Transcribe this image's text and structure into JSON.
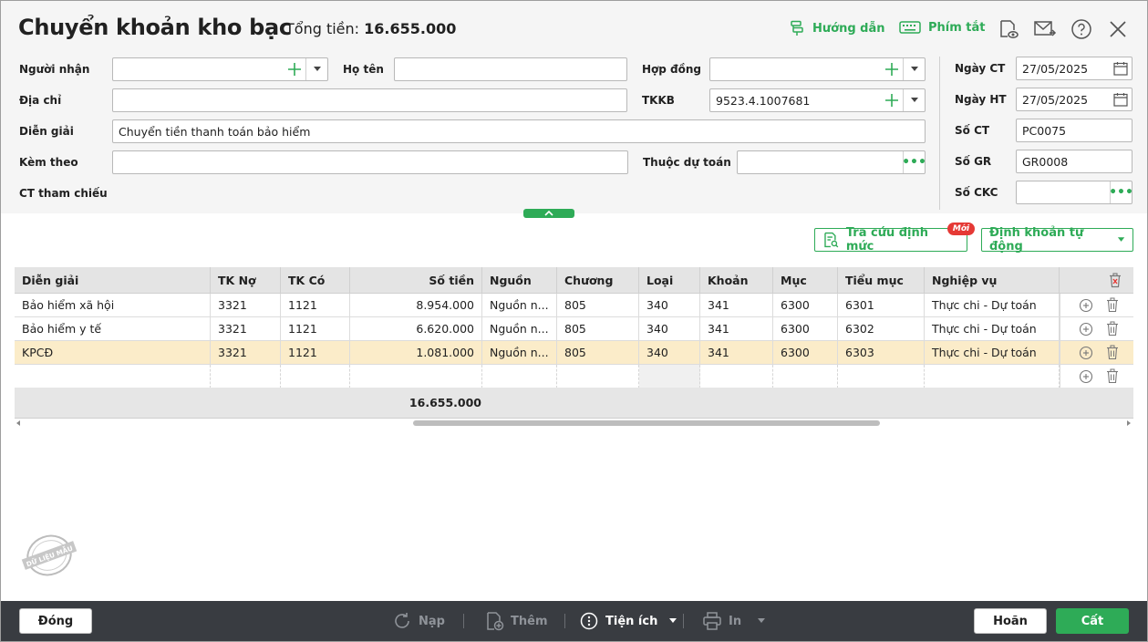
{
  "header": {
    "title": "Chuyển khoản kho bạc",
    "total_label": "Tổng tiền:",
    "total_value": "16.655.000",
    "guide_label": "Hướng dẫn",
    "shortcut_label": "Phím tắt"
  },
  "form": {
    "nguoi_nhan_label": "Người nhận",
    "nguoi_nhan_value": "",
    "ho_ten_label": "Họ tên",
    "ho_ten_value": "",
    "hop_dong_label": "Hợp đồng",
    "hop_dong_value": "",
    "dia_chi_label": "Địa chỉ",
    "dia_chi_value": "",
    "tkkb_label": "TKKB",
    "tkkb_value": "9523.4.1007681",
    "dien_giai_label": "Diễn giải",
    "dien_giai_value": "Chuyển tiền thanh toán bảo hiểm",
    "kem_theo_label": "Kèm theo",
    "kem_theo_value": "",
    "thuoc_du_toan_label": "Thuộc dự toán",
    "thuoc_du_toan_value": "",
    "ct_tham_chieu_label": "CT tham chiếu"
  },
  "side": {
    "ngay_ct_label": "Ngày CT",
    "ngay_ct_value": "27/05/2025",
    "ngay_ht_label": "Ngày HT",
    "ngay_ht_value": "27/05/2025",
    "so_ct_label": "Số CT",
    "so_ct_value": "PC0075",
    "so_gr_label": "Số GR",
    "so_gr_value": "GR0008",
    "so_ckc_label": "Số CKC",
    "so_ckc_value": ""
  },
  "actions": {
    "lookup_label": "Tra cứu định mức",
    "new_badge": "Mới",
    "auto_entry_label": "Định khoản tự động"
  },
  "grid": {
    "columns": [
      "Diễn giải",
      "TK Nợ",
      "TK Có",
      "Số tiền",
      "Nguồn",
      "Chương",
      "Loại",
      "Khoản",
      "Mục",
      "Tiểu mục",
      "Nghiệp vụ"
    ],
    "rows": [
      [
        "Bảo hiểm xã hội",
        "3321",
        "1121",
        "8.954.000",
        "Nguồn n...",
        "805",
        "340",
        "341",
        "6300",
        "6301",
        "Thực chi - Dự toán"
      ],
      [
        "Bảo hiểm y tế",
        "3321",
        "1121",
        "6.620.000",
        "Nguồn n...",
        "805",
        "340",
        "341",
        "6300",
        "6302",
        "Thực chi - Dự toán"
      ],
      [
        "KPCĐ",
        "3321",
        "1121",
        "1.081.000",
        "Nguồn n...",
        "805",
        "340",
        "341",
        "6300",
        "6303",
        "Thực chi - Dự toán"
      ]
    ],
    "total": "16.655.000",
    "selected_row_index": 2
  },
  "footer": {
    "close_label": "Đóng",
    "reload_label": "Nạp",
    "add_label": "Thêm",
    "utility_label": "Tiện ích",
    "print_label": "In",
    "cancel_label": "Hoãn",
    "save_label": "Cất"
  },
  "stamp_text": "DỮ LIỆU MẪU",
  "colors": {
    "accent": "#2eab57",
    "selected_row": "#fbecc9",
    "bottom_bar": "#393c41",
    "badge": "#e53935"
  }
}
